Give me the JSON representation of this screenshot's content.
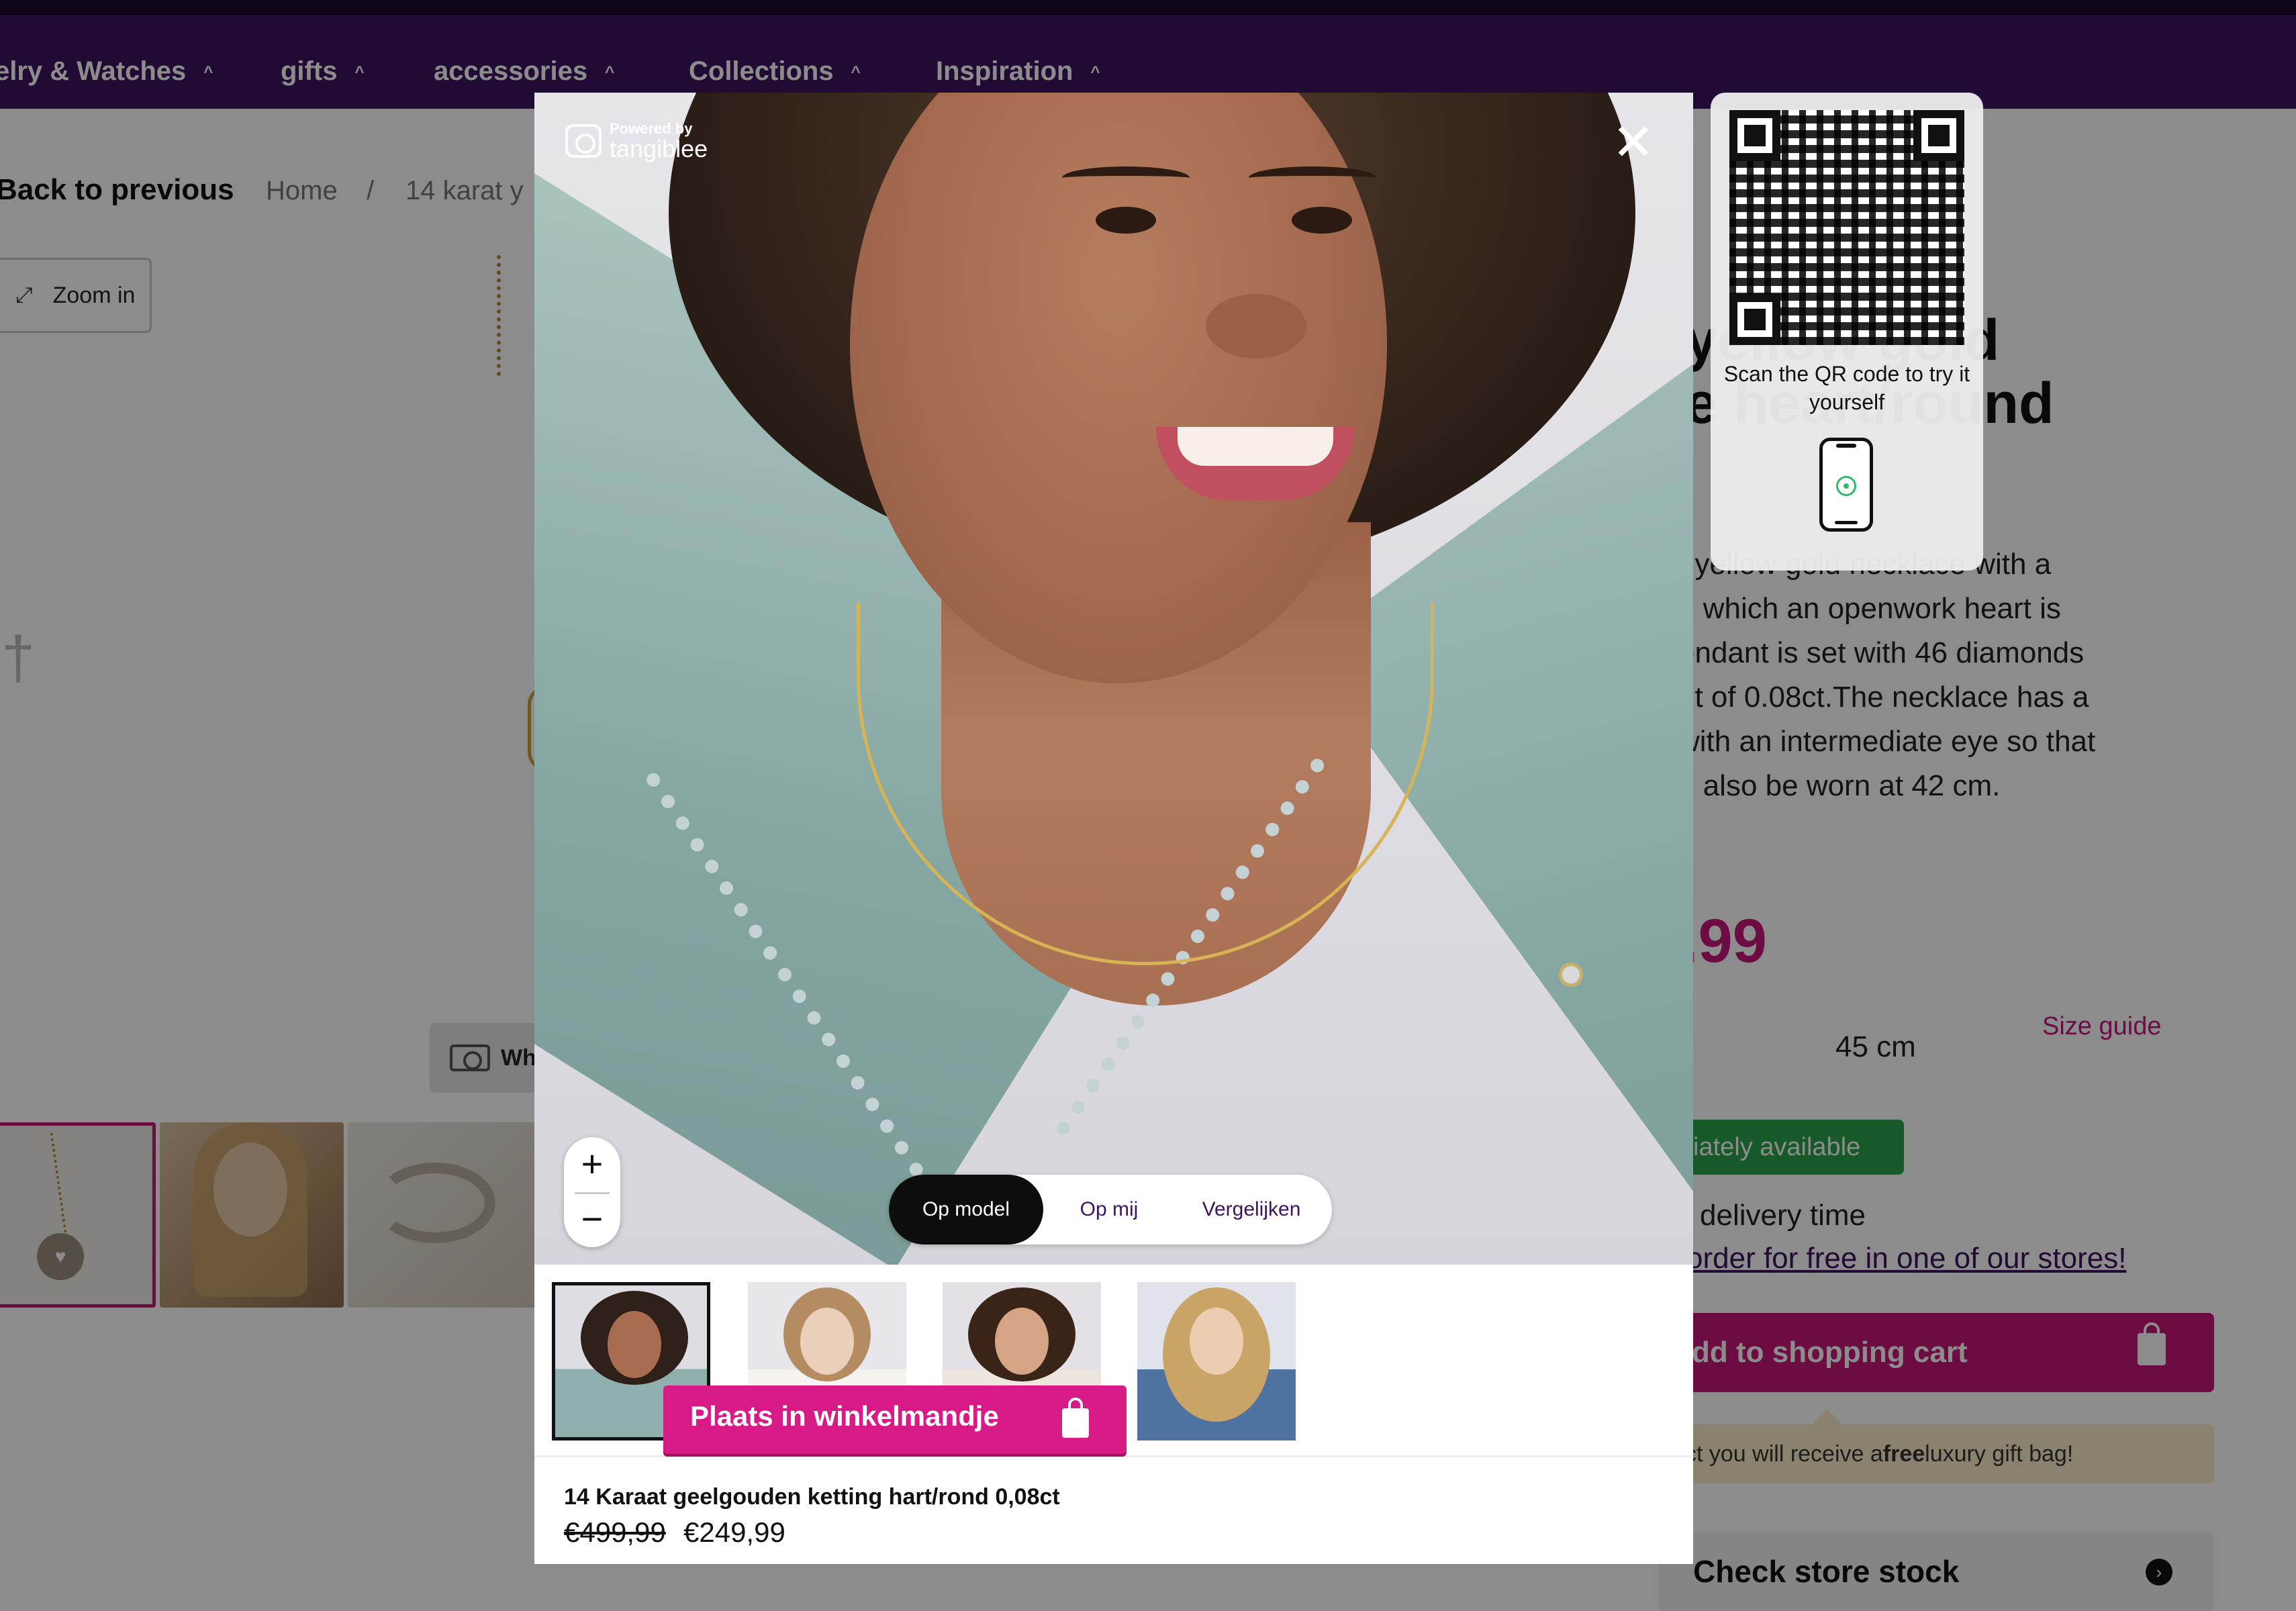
{
  "nav": {
    "items": [
      {
        "label": "elry & Watches"
      },
      {
        "label": "gifts"
      },
      {
        "label": "accessories"
      },
      {
        "label": "Collections"
      },
      {
        "label": "Inspiration"
      }
    ],
    "chevron": "^"
  },
  "breadcrumb": {
    "back": "Back to previous",
    "home": "Home",
    "separator": "/",
    "current": "14 karat y"
  },
  "gallery": {
    "zoom_label": "Zoom in",
    "camera_label": "Wh"
  },
  "product": {
    "title_line1": "yellow gold",
    "title_line2": "e heart/round",
    "desc_lines": [
      "t yellow gold necklace with a",
      "n which an openwork heart is",
      "endant is set with 46 diamonds",
      "nt of 0.08ct.The necklace has a",
      "with an intermediate eye so that",
      "n also be worn at 42 cm."
    ],
    "price_fragment": ".99",
    "size_value": "45 cm",
    "size_guide": "Size guide",
    "availability": "iately available",
    "delivery": "delivery time",
    "order_free": "order for free in one of our stores!",
    "add_to_cart": "dd to shopping cart",
    "gift_note_pre": "ct you will receive a ",
    "gift_note_bold": "free",
    "gift_note_post": " luxury gift bag!",
    "store_stock": "Check store stock"
  },
  "modal": {
    "powered_by": "Powered by",
    "brand": "tangiblee",
    "close_symbol": "✕",
    "zoom_in_symbol": "+",
    "zoom_out_symbol": "−",
    "modes": [
      "Op model",
      "Op mij",
      "Vergelijken"
    ],
    "active_mode": "Op model",
    "models_count": 4,
    "product_name": "14 Karaat geelgouden ketting hart/rond 0,08ct",
    "old_price": "€499,99",
    "new_price": "€249,99",
    "cta": "Plaats in winkelmandje"
  },
  "qr": {
    "text": "Scan the QR code to try it yourself"
  },
  "colors": {
    "nav_bg": "#3d145f",
    "accent_pink": "#d81a86",
    "available_green": "#2aa24a"
  }
}
